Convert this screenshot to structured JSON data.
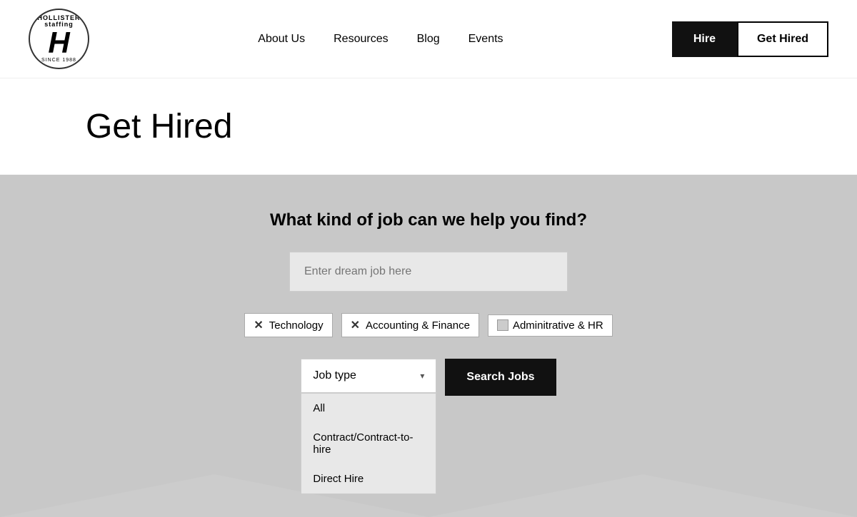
{
  "header": {
    "logo": {
      "staffing_text": "HOLLISTER staffing",
      "letter": "H",
      "since": "SINCE 1988"
    },
    "nav": {
      "items": [
        {
          "label": "About Us",
          "id": "about-us"
        },
        {
          "label": "Resources",
          "id": "resources"
        },
        {
          "label": "Blog",
          "id": "blog"
        },
        {
          "label": "Events",
          "id": "events"
        }
      ]
    },
    "buttons": {
      "hire": "Hire",
      "get_hired": "Get Hired"
    }
  },
  "page_title_section": {
    "title": "Get Hired"
  },
  "search_section": {
    "headline": "What kind of job can we help you find?",
    "input_placeholder": "Enter dream job here",
    "categories": [
      {
        "label": "Technology",
        "checked": true
      },
      {
        "label": "Accounting & Finance",
        "checked": true
      },
      {
        "label": "Adminitrative & HR",
        "checked": false
      }
    ],
    "job_type_dropdown": {
      "label": "Job type",
      "options": [
        {
          "label": "All"
        },
        {
          "label": "Contract/Contract-to-hire"
        },
        {
          "label": "Direct Hire"
        }
      ]
    },
    "search_button": "Search Jobs"
  }
}
